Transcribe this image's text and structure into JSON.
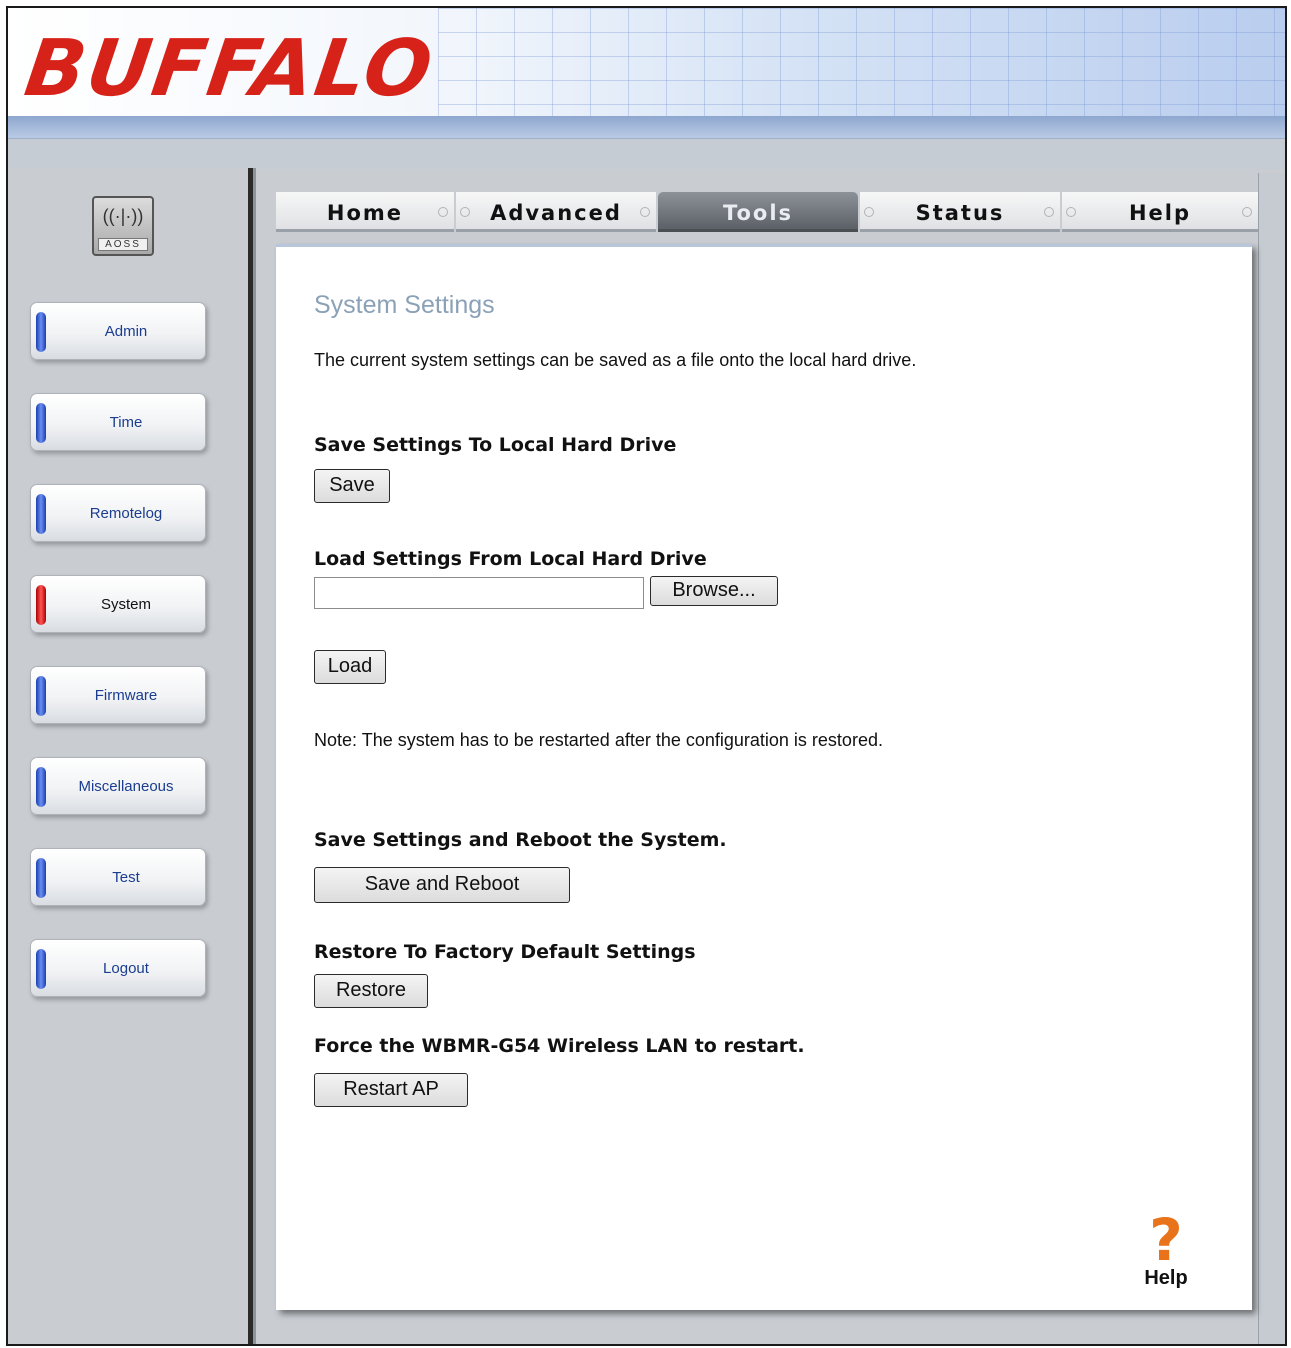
{
  "brand": {
    "logo": "BUFFALO"
  },
  "sidebar": {
    "aoss_label": "AOSS",
    "items": [
      {
        "label": "Admin",
        "active": false
      },
      {
        "label": "Time",
        "active": false
      },
      {
        "label": "Remotelog",
        "active": false
      },
      {
        "label": "System",
        "active": true
      },
      {
        "label": "Firmware",
        "active": false
      },
      {
        "label": "Miscellaneous",
        "active": false
      },
      {
        "label": "Test",
        "active": false
      },
      {
        "label": "Logout",
        "active": false
      }
    ]
  },
  "tabs": [
    {
      "label": "Home",
      "active": false
    },
    {
      "label": "Advanced",
      "active": false
    },
    {
      "label": "Tools",
      "active": true
    },
    {
      "label": "Status",
      "active": false
    },
    {
      "label": "Help",
      "active": false
    }
  ],
  "main": {
    "title": "System Settings",
    "description": "The current system settings can be saved as a file onto the local hard drive.",
    "save_section": {
      "heading": "Save Settings To Local Hard Drive",
      "button": "Save"
    },
    "load_section": {
      "heading": "Load Settings From Local Hard Drive",
      "file_value": "",
      "browse_button": "Browse...",
      "load_button": "Load"
    },
    "note": "Note: The system has to be restarted after the configuration is restored.",
    "reboot_section": {
      "heading": "Save Settings and Reboot the System.",
      "button": "Save and Reboot"
    },
    "restore_section": {
      "heading": "Restore To Factory Default Settings",
      "button": "Restore"
    },
    "restart_section": {
      "heading": "Force the WBMR-G54 Wireless LAN to restart.",
      "button": "Restart AP"
    },
    "help_label": "Help"
  },
  "colors": {
    "brand_red": "#d62218",
    "title_gray_blue": "#8aa1b7",
    "active_led": "#e33333",
    "inactive_led": "#2a55d0",
    "help_orange": "#e8731a"
  }
}
